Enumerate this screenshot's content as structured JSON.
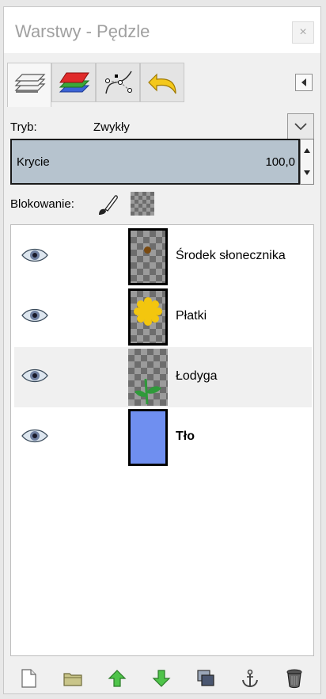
{
  "window": {
    "title": "Warstwy - Pędzle",
    "close": "×"
  },
  "tabs": [
    {
      "name": "layers-tab-icon"
    },
    {
      "name": "channels-tab-icon"
    },
    {
      "name": "paths-tab-icon"
    },
    {
      "name": "undo-history-tab-icon"
    }
  ],
  "mode": {
    "label": "Tryb:",
    "value": "Zwykły"
  },
  "opacity": {
    "label": "Krycie",
    "value": "100,0"
  },
  "lock": {
    "label": "Blokowanie:"
  },
  "layers": [
    {
      "name": "Środek słonecznika",
      "visible": true,
      "bold": false
    },
    {
      "name": "Płatki",
      "visible": true,
      "bold": false
    },
    {
      "name": "Łodyga",
      "visible": true,
      "bold": false,
      "selected": true
    },
    {
      "name": "Tło",
      "visible": true,
      "bold": true
    }
  ],
  "colors": {
    "background_layer": "#6f8ff0",
    "petals": "#f3c60e",
    "center": "#7a4a10",
    "stem": "#2f9a3a",
    "opacity_fill": "#b6c3ce"
  }
}
